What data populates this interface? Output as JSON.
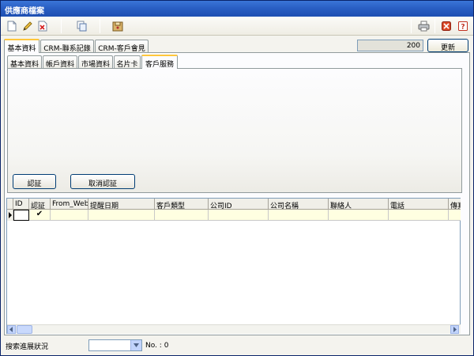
{
  "window": {
    "title": "供應商檔案"
  },
  "toolbar": {
    "icons": [
      "new-document-icon",
      "edit-pencil-icon",
      "delete-icon",
      "copy-icon",
      "save-icon",
      "print-icon",
      "close-icon",
      "help-icon"
    ]
  },
  "top_tabs": [
    {
      "label": "基本資料",
      "active": true
    },
    {
      "label": "CRM-聯系記錄",
      "active": false
    },
    {
      "label": "CRM-客戶會見",
      "active": false
    }
  ],
  "counter": {
    "value": "200"
  },
  "refresh_label": "更新",
  "inner_tabs": [
    {
      "label": "基本資料",
      "active": false
    },
    {
      "label": "帳戶資料",
      "active": false
    },
    {
      "label": "市場資料",
      "active": false
    },
    {
      "label": "名片卡",
      "active": false
    },
    {
      "label": "客戶服務",
      "active": true
    }
  ],
  "buttons": {
    "certify": "認証",
    "uncertify": "取消認証"
  },
  "grid": {
    "columns": [
      "ID",
      "認証",
      "From_Web",
      "提醒日期",
      "客戶類型",
      "公司ID",
      "公司名稱",
      "聯絡人",
      "電話",
      "傳真"
    ],
    "rows": [
      {
        "id": "",
        "certified": "✔",
        "from_web": "",
        "remind_date": "",
        "client_type": "",
        "company_id": "",
        "company_name": "",
        "contact": "",
        "phone": "",
        "fax": ""
      }
    ]
  },
  "status": {
    "label": "搜索進展狀況",
    "select_value": "",
    "no_label": "No. : 0"
  },
  "colors": {
    "titlebar": "#2a5fc4",
    "active_tab_accent": "#ffc73c",
    "selected_row": "#ffffe1"
  }
}
